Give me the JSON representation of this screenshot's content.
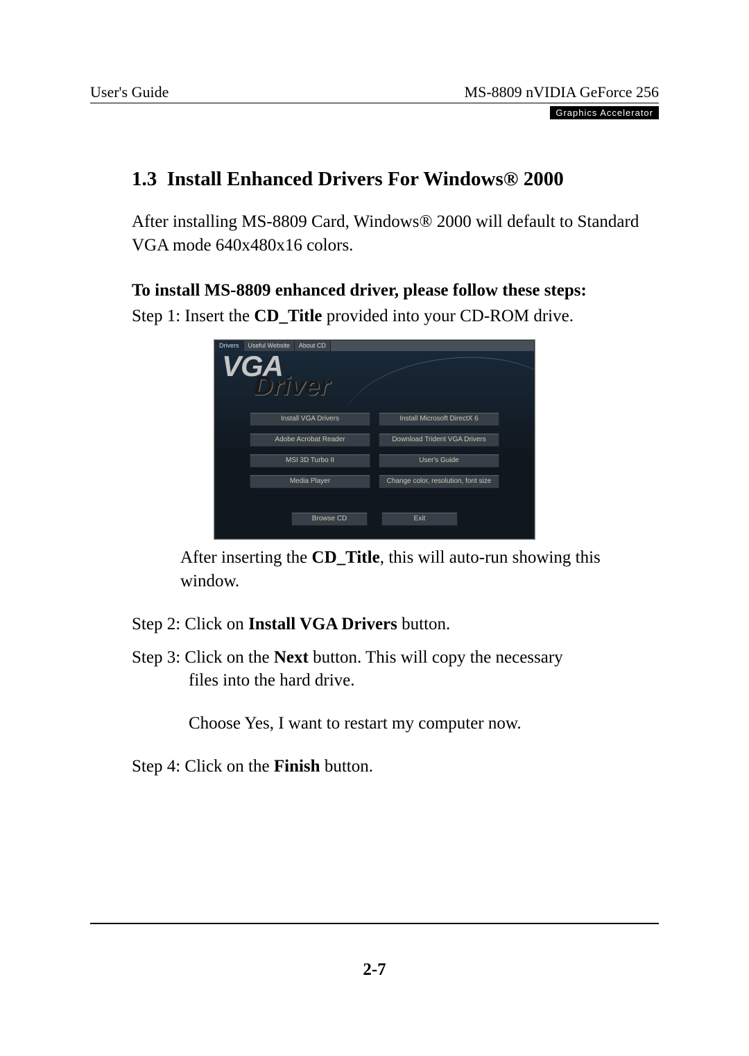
{
  "header": {
    "left": "User's Guide",
    "right": "MS-8809 nVIDIA GeForce 256",
    "badge": "Graphics Accelerator"
  },
  "section": {
    "number": "1.3",
    "title": "Install Enhanced Drivers For Windows® 2000"
  },
  "intro": {
    "pre": "After installing MS-8809 Card,  Windows",
    "reg": "®",
    "post": " 2000 will default to Standard VGA mode 640x480x16 colors."
  },
  "instr_heading": "To install MS-8809 enhanced driver, please follow these steps:",
  "step1": {
    "label": "Step 1:  Insert the ",
    "bold": "CD_Title",
    "tail": " provided into your CD-ROM drive."
  },
  "figure": {
    "tabs": [
      "Drivers",
      "Useful Website",
      "About CD"
    ],
    "logo_top": "VGA",
    "logo_bottom": "Driver",
    "buttons": [
      "Install VGA Drivers",
      "Install Microsoft DirectX 6",
      "Adobe Acrobat Reader",
      "Download Trident VGA Drivers",
      "MSI 3D Turbo II",
      "User's Guide",
      "Media Player",
      "Change color, resolution, font size"
    ],
    "bottom": [
      "Browse CD",
      "Exit"
    ]
  },
  "caption": {
    "pre": "After inserting the ",
    "bold": "CD_Title",
    "post": ", this will auto-run showing this window."
  },
  "step2": {
    "label": "Step 2:  Click on ",
    "bold": "Install VGA Drivers",
    "tail": " button."
  },
  "step3": {
    "label": "Step 3:  Click on the ",
    "bold": "Next",
    "tail": " button.  This will copy the necessary",
    "line2": "files into the hard drive.",
    "line3": "Choose Yes, I want to restart my computer now."
  },
  "step4": {
    "label": "Step 4:  Click on the ",
    "bold": "Finish",
    "tail": " button."
  },
  "page_num": "2-7"
}
